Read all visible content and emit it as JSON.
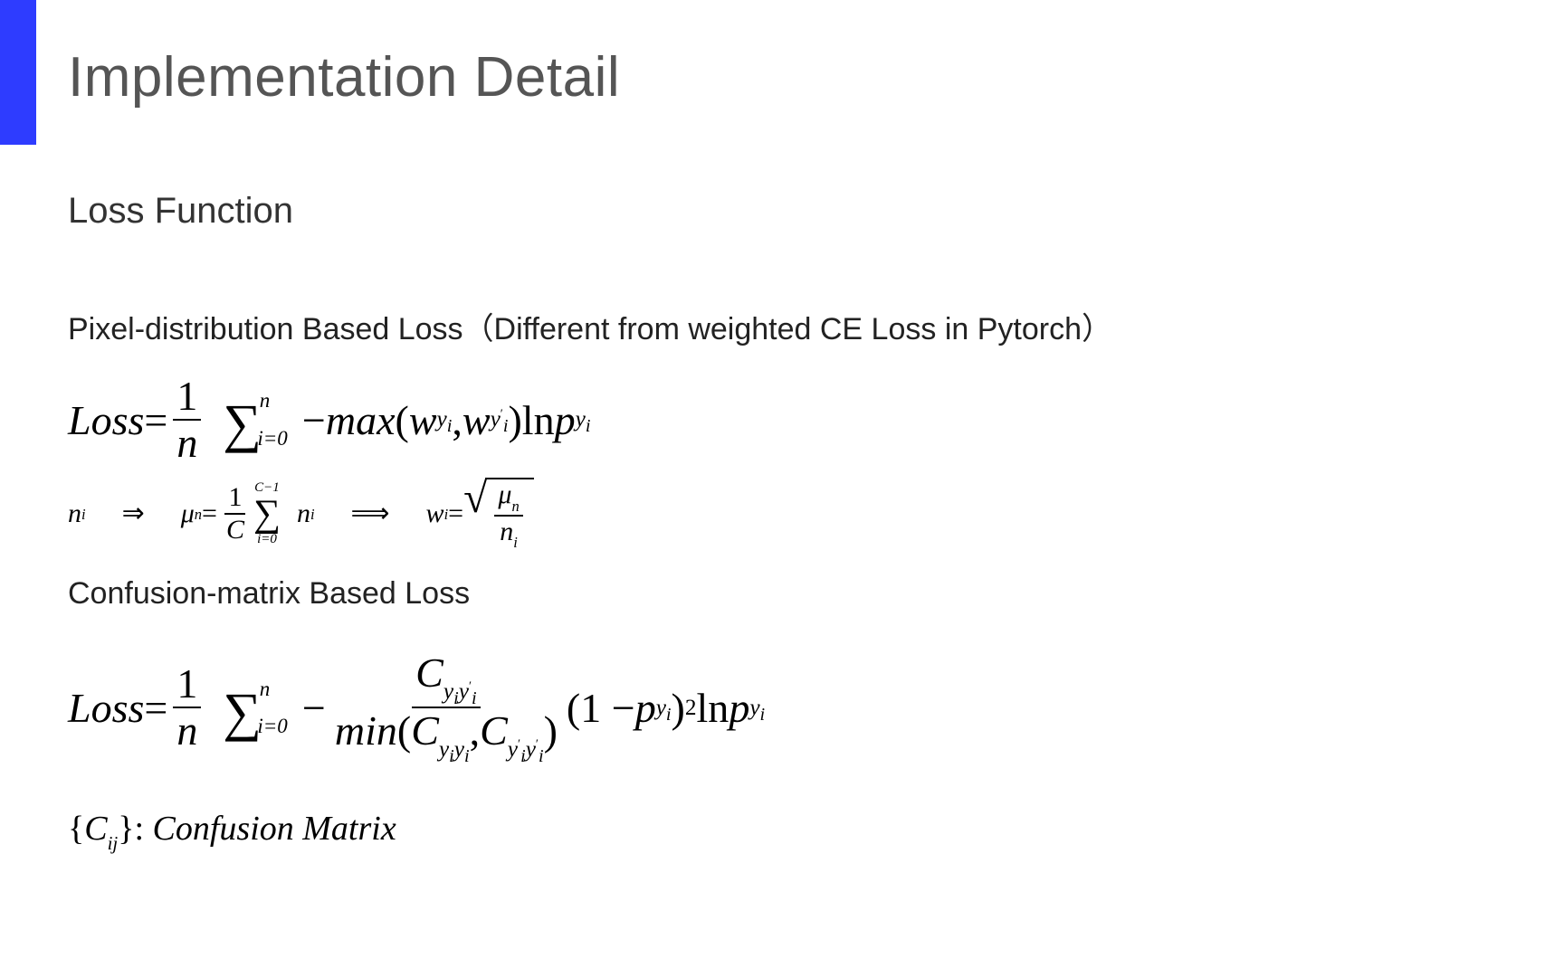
{
  "title": "Implementation Detail",
  "section": "Loss Function",
  "sub1_label": "Pixel-distribution Based Loss",
  "sub1_note": "（Different from weighted CE Loss in Pytorch）",
  "sub2_label": "Confusion-matrix Based Loss",
  "eq1": {
    "lhs": "Loss",
    "eq": " = ",
    "frac1_num": "1",
    "frac1_den": "n",
    "sum_top": "n",
    "sum_bot": "i=0",
    "minus": " −",
    "maxw": "max",
    "lp": "(",
    "w": "w",
    "y": "y",
    "i": "i",
    "comma": ", ",
    "prime": "′",
    "rp": ")",
    "ln": " ln ",
    "p": "p"
  },
  "eq2": {
    "ni": "n",
    "i": "i",
    "arrow1": "⇒",
    "mu": "μ",
    "n": "n",
    "eq": " = ",
    "frac_num": "1",
    "frac_den": "C",
    "sum_top": "C−1",
    "sum_bot": "i=0",
    "arrow2": "⟹",
    "w": "w",
    "sqrt_num": "μ",
    "sqrt_den": "n"
  },
  "eq3": {
    "lhs": "Loss",
    "eq": " = ",
    "frac1_num": "1",
    "frac1_den": "n",
    "sum_top": "n",
    "sum_bot": "i=0",
    "minus": " − ",
    "C": "C",
    "y": "y",
    "i": "i",
    "prime": "′",
    "min": "min",
    "lp": "(",
    "comma": ",",
    "rp": ")",
    "one_minus_p_l": "(1 − ",
    "p": "p",
    "one_minus_p_r": ")",
    "sq": "2",
    "ln": " ln "
  },
  "eq4": {
    "lb": "{",
    "C": "C",
    "ij": "ij",
    "rb": "}",
    "colon": ": ",
    "label": "Confusion Matrix"
  }
}
